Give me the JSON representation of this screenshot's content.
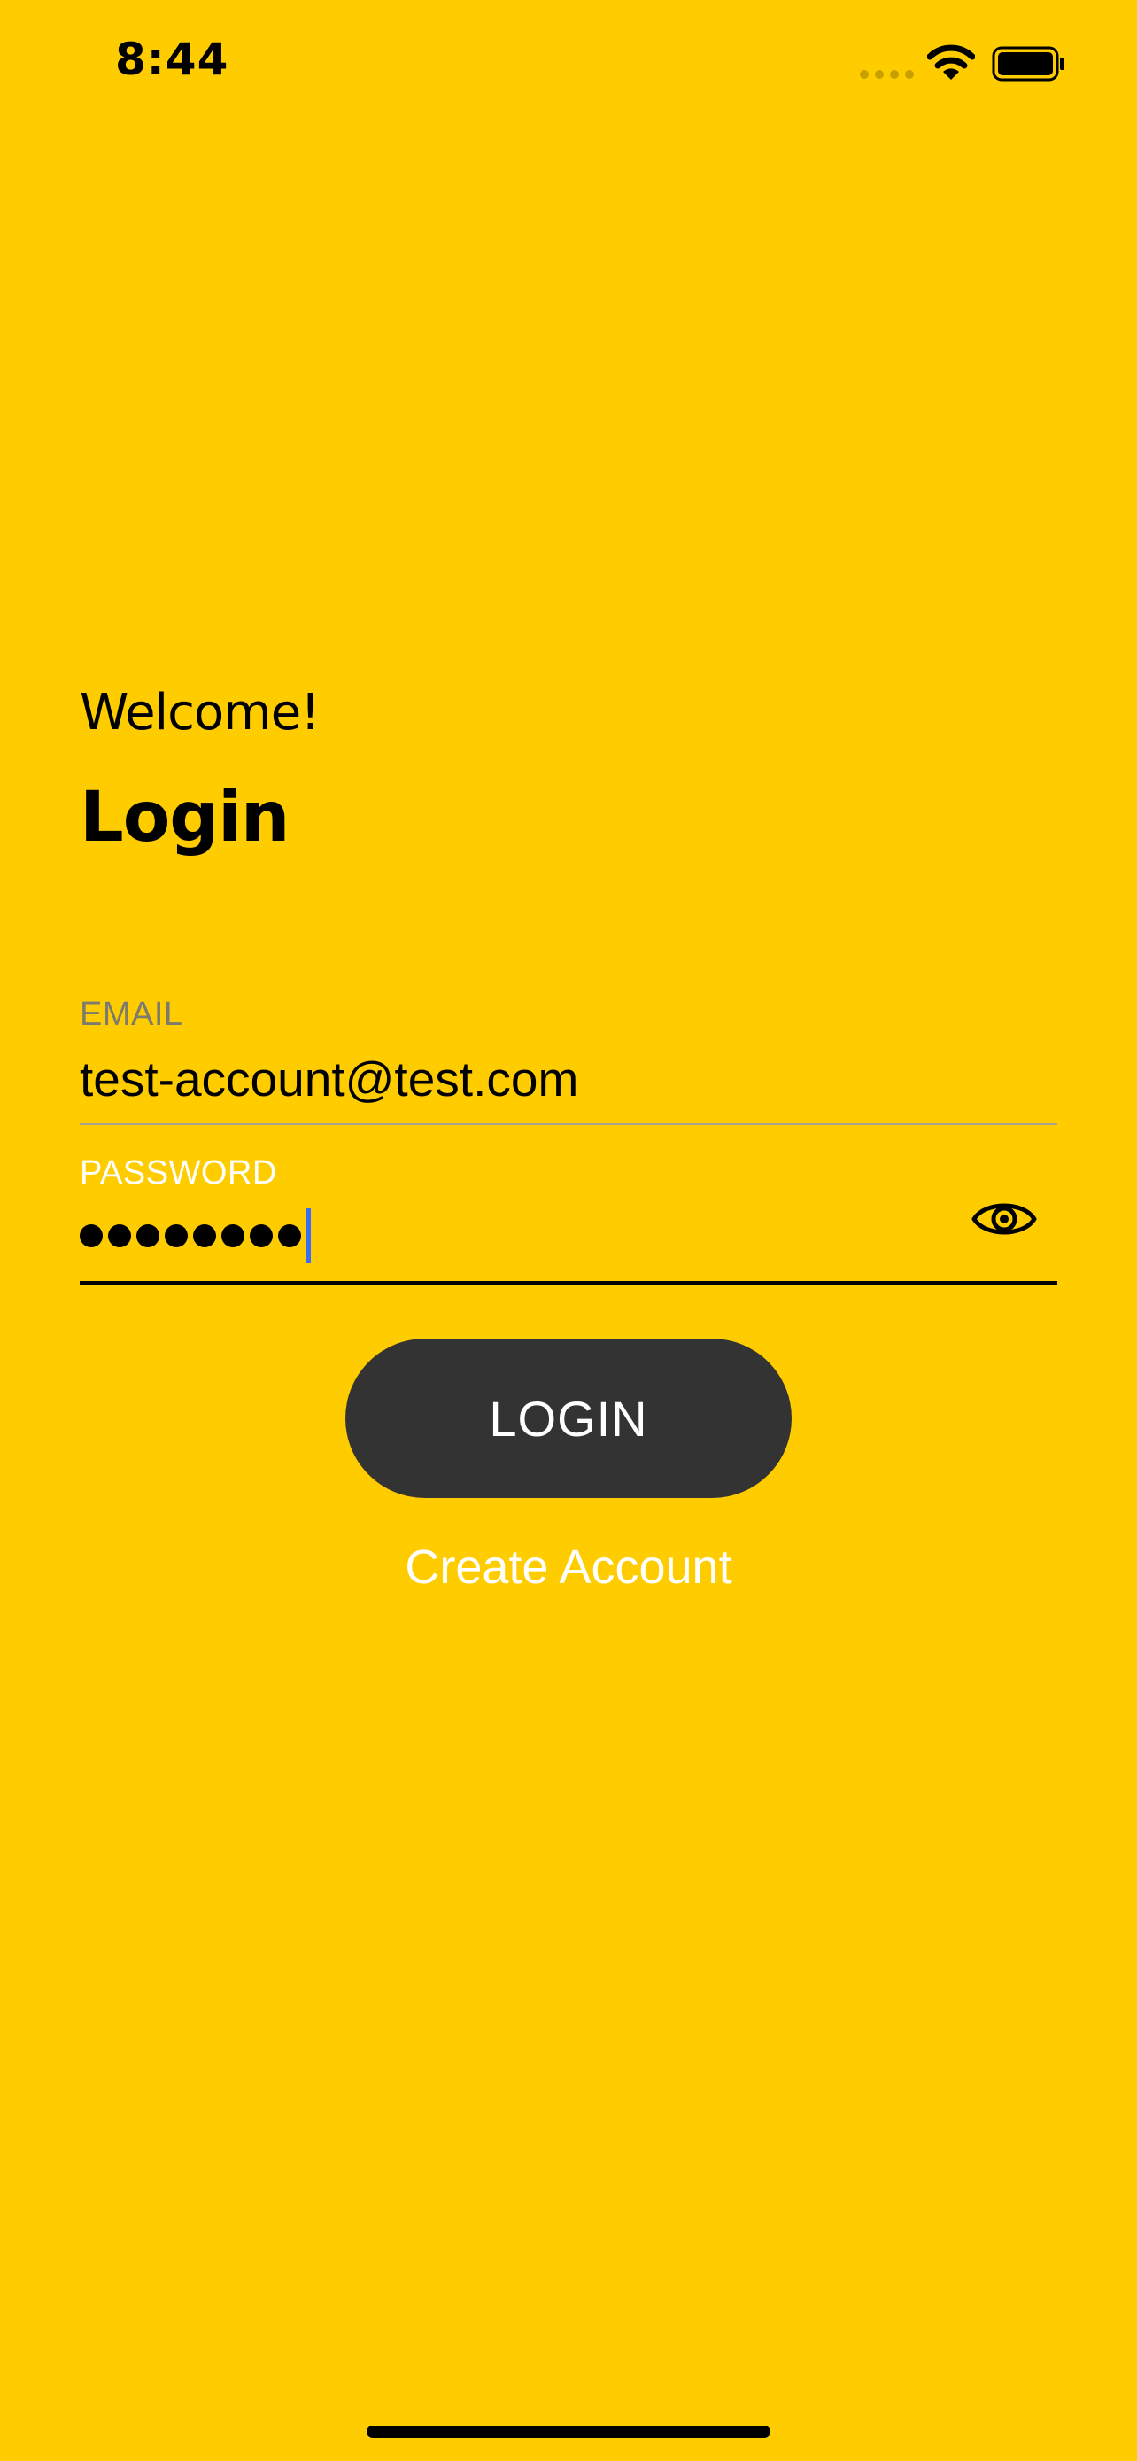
{
  "status_bar": {
    "time": "8:44",
    "signal_icon": "cellular-signal-dots-icon",
    "wifi_icon": "wifi-icon",
    "battery_icon": "battery-full-icon"
  },
  "header": {
    "welcome": "Welcome!",
    "title": "Login"
  },
  "form": {
    "email": {
      "label": "EMAIL",
      "value": "test-account@test.com"
    },
    "password": {
      "label": "PASSWORD",
      "masked_length": 8,
      "toggle_icon": "eye-icon"
    },
    "login_button": "LOGIN",
    "create_account_link": "Create Account"
  },
  "colors": {
    "background": "#FFCC00",
    "button": "#333333",
    "cursor": "#3B6CF4"
  }
}
